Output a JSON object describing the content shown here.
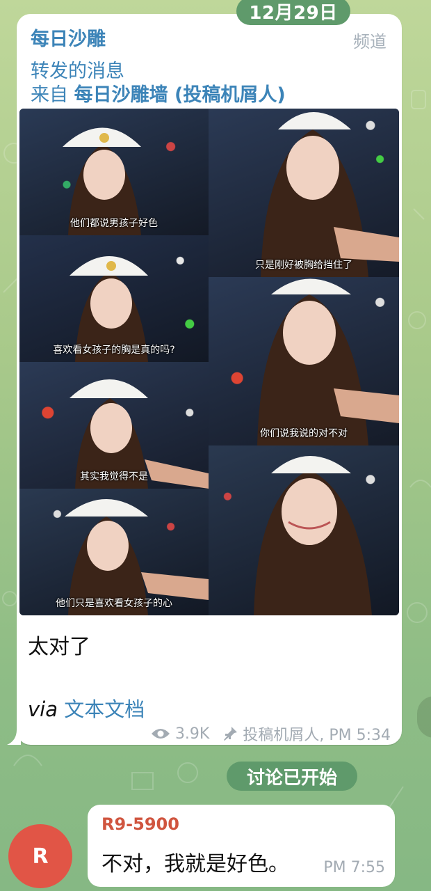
{
  "date_chip": "12月29日",
  "post": {
    "channel_name": "每日沙雕",
    "channel_tag": "频道",
    "forwarded_label": "转发的消息",
    "forwarded_from_prefix": "来自",
    "forwarded_from_name": "每日沙雕墙 (投稿机屑人)",
    "image_captions": [
      "他们都说男孩子好色",
      "喜欢看女孩子的胸是真的吗?",
      "其实我觉得不是",
      "他们只是喜欢看女孩子的心",
      "只是刚好被胸给挡住了",
      "你们说我说的对不对"
    ],
    "text": "太对了",
    "via_prefix": "via",
    "via_link": "文本文档",
    "views": "3.9K",
    "author_time": "投稿机屑人, PM 5:34"
  },
  "discussion_chip": "讨论已开始",
  "reply": {
    "avatar_letter": "R",
    "avatar_color": "#e15546",
    "author": "R9-5900",
    "text": "不对，我就是好色。",
    "time": "PM 7:55"
  },
  "colors": {
    "link_blue": "#3c84b8",
    "chip_green": "#5f9a6b",
    "meta_gray": "#a3abb3"
  },
  "icons": [
    "eye-icon",
    "pin-icon"
  ]
}
